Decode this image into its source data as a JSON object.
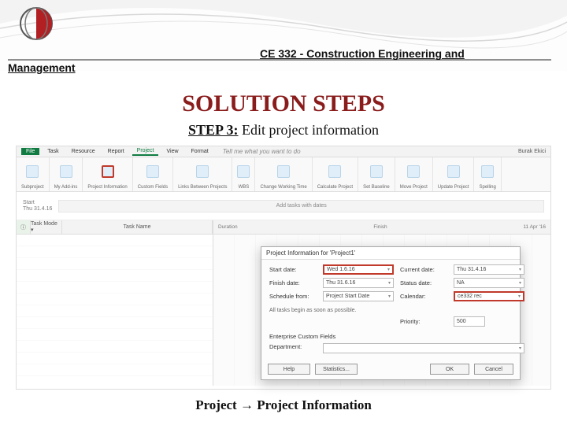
{
  "course": {
    "line1": "CE 332 - Construction Engineering and",
    "line2": "Management"
  },
  "page": {
    "title": "SOLUTION STEPS",
    "step_label": "STEP 3:",
    "step_text": "Edit project information",
    "footer": "Project  →  Project Information"
  },
  "app": {
    "tabs": {
      "file": "File",
      "task": "Task",
      "resource": "Resource",
      "report": "Report",
      "project": "Project",
      "view": "View",
      "format": "Format",
      "tell": "Tell me what you want to do",
      "user": "Burak Ekici"
    },
    "ribbon": {
      "g1": "Subproject",
      "g2": "My Add-ins",
      "g3": "Project Information",
      "g4": "Custom Fields",
      "g5": "Links Between Projects",
      "g6": "WBS",
      "g7": "Change Working Time",
      "g8": "Calculate Project",
      "g9": "Set Baseline",
      "g10": "Move Project",
      "g11": "Update Project",
      "g12": "Spelling"
    },
    "timeline": {
      "start_lbl": "Start",
      "start_val": "Thu 31.4.16",
      "hint": "Add tasks with dates"
    },
    "grid": {
      "info": "ⓘ",
      "mode": "Task Mode ▾",
      "name": "Task Name",
      "duration": "Duration",
      "finish": "Finish",
      "right_date": "11 Apr '16"
    },
    "dialog": {
      "title": "Project Information for 'Project1'",
      "start_date_lbl": "Start date:",
      "start_date_val": "Wed 1.6.16",
      "current_date_lbl": "Current date:",
      "current_date_val": "Thu 31.4.16",
      "finish_date_lbl": "Finish date:",
      "finish_date_val": "Thu 31.6.16",
      "status_date_lbl": "Status date:",
      "status_date_val": "NA",
      "schedule_from_lbl": "Schedule from:",
      "schedule_from_val": "Project Start Date",
      "calendar_lbl": "Calendar:",
      "calendar_val": "ce332 rec",
      "note": "All tasks begin as soon as possible.",
      "priority_lbl": "Priority:",
      "priority_val": "500",
      "ecf": "Enterprise Custom Fields",
      "dept_lbl": "Department:",
      "help": "Help",
      "stats": "Statistics...",
      "ok": "OK",
      "cancel": "Cancel"
    }
  }
}
